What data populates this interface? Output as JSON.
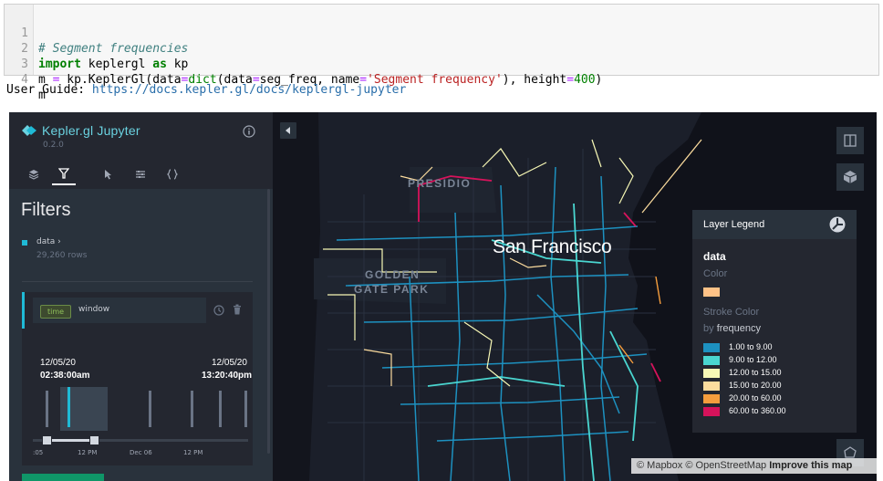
{
  "code_cell": {
    "lines": [
      {
        "num": "1",
        "comment": "# Segment frequencies"
      },
      {
        "num": "2",
        "kw1": "import",
        "mid": " keplergl ",
        "kw2": "as",
        "end": " kp"
      },
      {
        "num": "3",
        "a": "m ",
        "eq": "=",
        "b": " kp.KeplerGl(data",
        "eq2": "=",
        "fn": "dict",
        "c": "(data",
        "eq3": "=",
        "d": "seg_freq, name",
        "eq4": "=",
        "str": "'Segment frequency'",
        "e": "), height",
        "eq5": "=",
        "num_val": "400",
        "f": ")"
      },
      {
        "num": "4",
        "text": "m"
      }
    ]
  },
  "user_guide": {
    "label": "User Guide: ",
    "link": "https://docs.kepler.gl/docs/keplergl-jupyter"
  },
  "sidebar": {
    "app_title": "Kepler.gl Jupyter",
    "version": "0.2.0",
    "tabs": [
      "layers-icon",
      "filter-icon",
      "interaction-icon",
      "map-style-icon",
      "code-icon"
    ],
    "panel_title": "Filters",
    "dataset": {
      "name": "data",
      "rows": "29,260 rows"
    },
    "filter": {
      "type_tag": "time",
      "field": "window",
      "start_date": "12/05/20",
      "start_time": "02:38:00am",
      "end_date": "12/05/20",
      "end_time": "13:20:40pm",
      "ticks": [
        ":05",
        "12 PM",
        "Dec 06",
        "12 PM"
      ]
    }
  },
  "map": {
    "city_label": "San Francisco",
    "area_labels": [
      "PRESIDIO",
      "GOLDEN",
      "GATE PARK"
    ],
    "attribution": {
      "mapbox": "© Mapbox",
      "osm": "© OpenStreetMap",
      "improve": "Improve this map"
    }
  },
  "legend": {
    "title": "Layer Legend",
    "layer": "data",
    "color_label": "Color",
    "color_swatch": "#fec287",
    "stroke_label": "Stroke Color",
    "by_label": "by",
    "by_field": "frequency",
    "items": [
      {
        "color": "#1d91c0",
        "label": "1.00 to 9.00"
      },
      {
        "color": "#4ad6d0",
        "label": "9.00 to 12.00"
      },
      {
        "color": "#f7f8b5",
        "label": "12.00 to 15.00"
      },
      {
        "color": "#fcdc9e",
        "label": "15.00 to 20.00"
      },
      {
        "color": "#f59d3d",
        "label": "20.00 to 60.00"
      },
      {
        "color": "#d6135b",
        "label": "60.00 to 360.00"
      }
    ]
  }
}
